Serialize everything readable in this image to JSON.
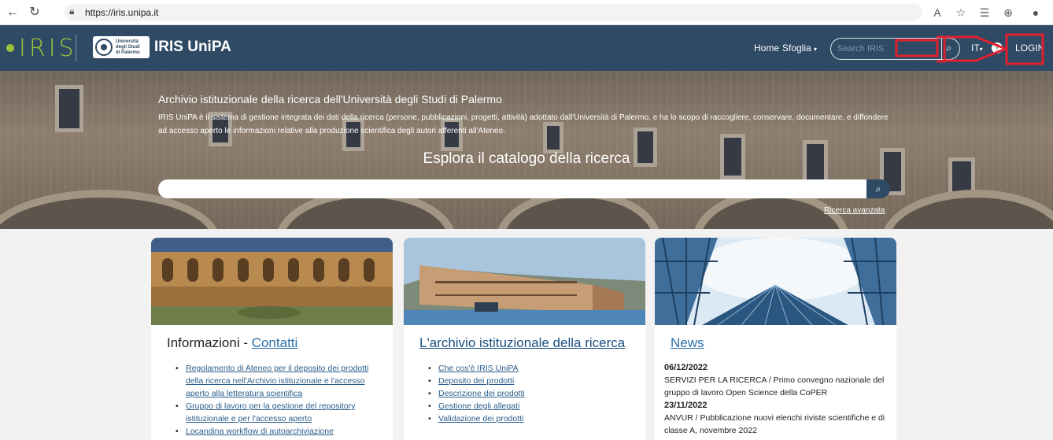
{
  "browser": {
    "url": "https://iris.unipa.it"
  },
  "navbar": {
    "logo_word": "IRIS",
    "unipa_lines": [
      "Università",
      "degli Studi",
      "di Palermo"
    ],
    "brand_title": "IRIS UniPA",
    "home_label": "Home",
    "browse_label": "Sfoglia",
    "search_placeholder": "Search IRIS",
    "lang_label": "IT",
    "login_label": "LOGIN"
  },
  "hero": {
    "title": "Archivio istituzionale della ricerca dell'Università degli Studi di Palermo",
    "description": "IRIS UniPA è il sistema di gestione integrata dei dati della ricerca (persone, pubblicazioni, progetti, attività) adottato dall'Università di Palermo, e ha lo scopo di raccogliere, conservare, documentare, e diffondere ad accesso aperto le informazioni relative alla produzione scientifica degli autori afferenti all'Ateneo.",
    "explore": "Esplora il catalogo della ricerca",
    "advanced_link": "Ricerca avanzata"
  },
  "cards": {
    "info": {
      "title": "Informazioni - ",
      "title_link": "Contatti",
      "items": [
        "Regolamento di Ateneo per il deposito dei prodotti della ricerca nell'Archivio istituzionale e l'accesso aperto alla letteratura scientifica",
        "Gruppo di lavoro per la gestione del repository istituzionale e per l'accesso aperto",
        "Locandina workflow di autoarchiviazione"
      ]
    },
    "archive": {
      "title": "L'archivio istituzionale della ricerca",
      "items": [
        "Che cos'è IRIS UniPA",
        "Deposito dei prodotti",
        "Descrizione dei prodotti",
        "Gestione degli allegati",
        "Validazione dei prodotti"
      ]
    },
    "news": {
      "title": "News",
      "entries": [
        {
          "date": "06/12/2022",
          "text": "SERVIZI PER LA RICERCA / Primo convegno nazionale del gruppo di lavoro Open Science della CoPER"
        },
        {
          "date": "23/11/2022",
          "text": "ANVUR / Pubblicazione nuovi elenchi riviste scientifiche e di classe A, novembre 2022"
        }
      ]
    }
  },
  "colors": {
    "navbar": "#2f4a64",
    "logo_green": "#9ec43b",
    "annotation_red": "#e0202e",
    "link_blue": "#2a6fa8"
  }
}
